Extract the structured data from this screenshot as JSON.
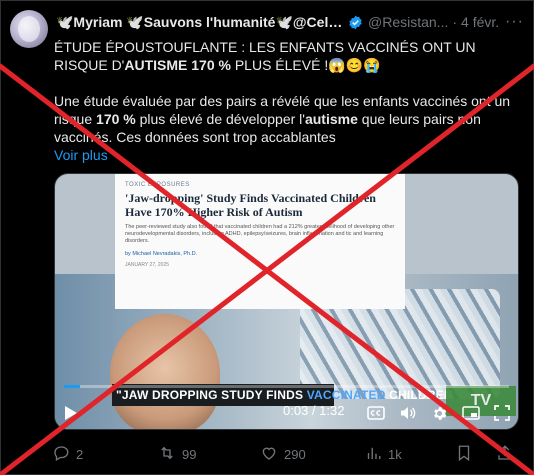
{
  "tweet": {
    "author": "🕊️Myriam 🕊️Sauvons l'humanité🕊️@Cele...",
    "handle": "@Resistan...",
    "separator": "·",
    "date": "4 févr.",
    "more_label": "···",
    "headline_1": "ÉTUDE ÉPOUSTOUFLANTE : LES ENFANTS VACCINÉS ONT UN RISQUE D'",
    "headline_bold": "AUTISME 170 %",
    "headline_2": " PLUS ÉLEVÉ !😱😊😭",
    "para_1": "Une étude évaluée par des pairs a révélé que les enfants vaccinés ont un risque ",
    "para_bold_1": "170 %",
    "para_2": " plus élevé de développer l'",
    "para_bold_2": "autisme",
    "para_3": " que leurs pairs non vaccinés. Ces données sont trop accablantes",
    "see_more": "Voir plus"
  },
  "media": {
    "article_kicker": "TOXIC EXPOSURES",
    "article_title": "'Jaw-dropping' Study Finds Vaccinated Children Have 170% Higher Risk of Autism",
    "article_body": "The peer-reviewed study also found that vaccinated children had a 212% greater likelihood of developing other neurodevelopmental disorders, including ADHD, epilepsy/seizures, brain inflammation and tic and learning disorders.",
    "article_by": "by Michael Nevradakis, Ph.D.",
    "article_date": "JANUARY 27, 2025",
    "caption_1": "\"JAW DROPPING STUDY FINDS ",
    "caption_hl": "VACCINATED",
    "caption_2": " CHILDREN",
    "logo_text": "TV",
    "time": "0:03 / 1:32",
    "progress": 0.035
  },
  "actions": {
    "replies": "2",
    "retweets": "99",
    "likes": "290",
    "views": "1k"
  },
  "colors": {
    "accent": "#1d9bf0",
    "cross": "#e0242a",
    "muted": "#71767b"
  }
}
